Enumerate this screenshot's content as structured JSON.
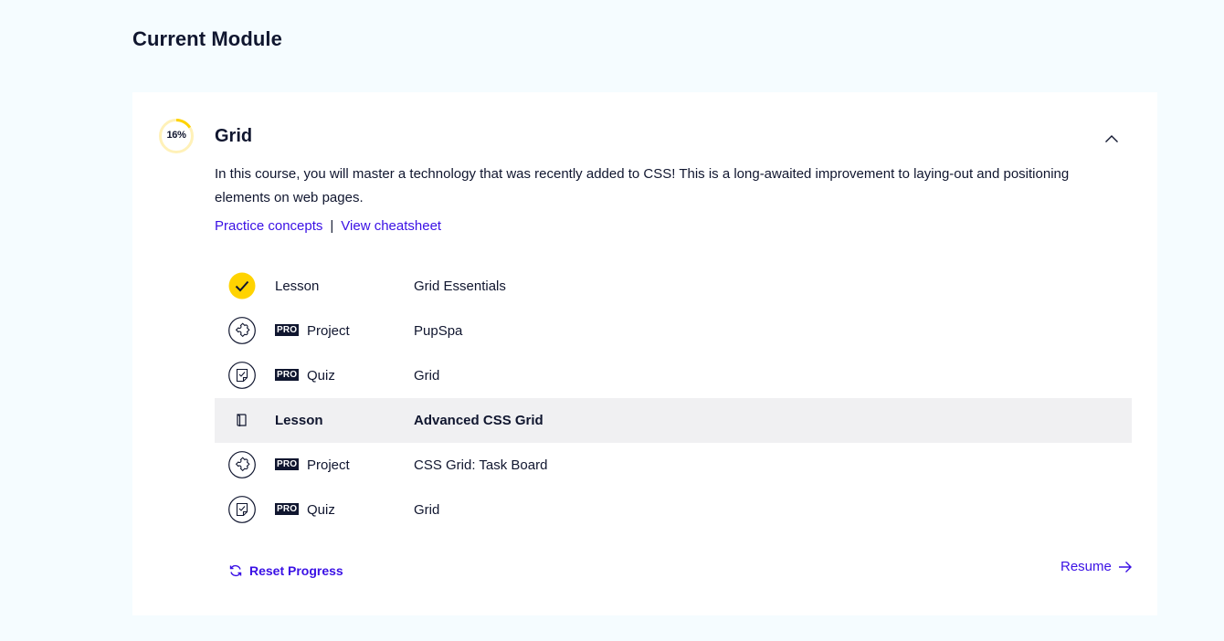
{
  "page": {
    "title": "Current Module"
  },
  "module": {
    "progress_label": "16%",
    "progress_value": 0.16,
    "title": "Grid",
    "description": "In this course, you will master a technology that was recently added to CSS! This is a long-awaited improvement to laying-out and positioning elements on web pages.",
    "links": {
      "practice": "Practice concepts",
      "separator": "|",
      "cheatsheet": "View cheatsheet"
    },
    "items": [
      {
        "icon": "check-icon",
        "pro": false,
        "type": "Lesson",
        "name": "Grid Essentials",
        "completed": true,
        "active": false
      },
      {
        "icon": "puzzle-icon",
        "pro": true,
        "pro_label": "PRO",
        "type": "Project",
        "name": "PupSpa",
        "completed": false,
        "active": false
      },
      {
        "icon": "quiz-icon",
        "pro": true,
        "pro_label": "PRO",
        "type": "Quiz",
        "name": "Grid",
        "completed": false,
        "active": false
      },
      {
        "icon": "book-icon",
        "pro": false,
        "type": "Lesson",
        "name": "Advanced CSS Grid",
        "completed": false,
        "active": true
      },
      {
        "icon": "puzzle-icon",
        "pro": true,
        "pro_label": "PRO",
        "type": "Project",
        "name": "CSS Grid: Task Board",
        "completed": false,
        "active": false
      },
      {
        "icon": "quiz-icon",
        "pro": true,
        "pro_label": "PRO",
        "type": "Quiz",
        "name": "Grid",
        "completed": false,
        "active": false
      }
    ],
    "actions": {
      "reset": "Reset Progress",
      "resume": "Resume"
    }
  },
  "colors": {
    "background": "#f5fcff",
    "accent": "#3a10e5",
    "progress": "#ffd300",
    "text": "#10162f"
  }
}
